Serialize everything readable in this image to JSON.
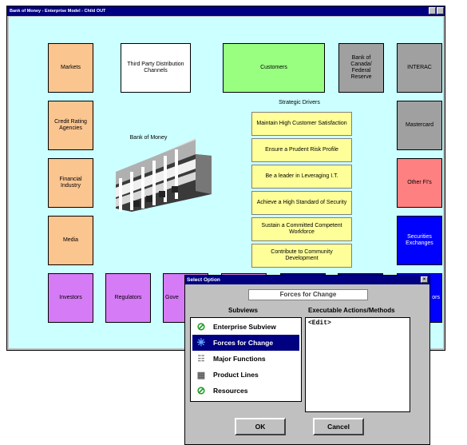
{
  "window": {
    "title": "Bank of Money - Enterprise Model - Child OUT"
  },
  "boxes": {
    "markets": "Markets",
    "third_party": "Third Party Distribution Channels",
    "customers": "Customers",
    "bank_of_canada": "Bank of Canada/ Federal Reserve",
    "interac": "INTERAC",
    "credit_rating": "Credit Rating Agencies",
    "mastercard": "Mastercard",
    "financial_industry": "Financial Industry",
    "other_fis": "Other FI's",
    "media": "Media",
    "securities": "Securities Exchanges",
    "investors": "Investors",
    "regulators": "Regulators",
    "gove": "Gove",
    "ors": "ors"
  },
  "bank_label": "Bank of Money",
  "strategic": {
    "title": "Strategic Drivers",
    "items": [
      "Maintain High Customer Satisfaction",
      "Ensure a Prudent Risk Profile",
      "Be a leader in Leveraging I.T.",
      "Achieve a High Standard of Security",
      "Sustain a Committed Competent Workforce",
      "Contribute to Community Development"
    ]
  },
  "dialog": {
    "title": "Select Option",
    "selected_value": "Forces for Change",
    "subviews_header": "Subviews",
    "actions_header": "Executable Actions/Methods",
    "subviews": [
      {
        "label": "Enterprise Subview",
        "icon": "green-check-icon"
      },
      {
        "label": "Forces for Change",
        "icon": "forces-icon",
        "selected": true
      },
      {
        "label": "Major Functions",
        "icon": "functions-icon"
      },
      {
        "label": "Product Lines",
        "icon": "product-lines-icon"
      },
      {
        "label": "Resources",
        "icon": "green-check-icon"
      }
    ],
    "actions": [
      "<Edit>"
    ],
    "ok_label": "OK",
    "cancel_label": "Cancel"
  },
  "colors": {
    "titlebar": "#000080",
    "background": "#ccffff",
    "selection": "#000080"
  }
}
